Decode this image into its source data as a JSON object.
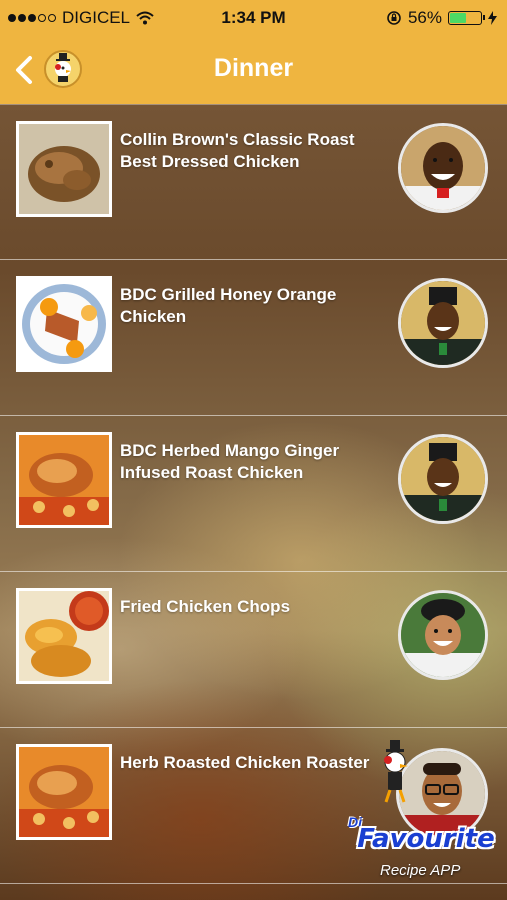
{
  "status_bar": {
    "carrier": "DIGICEL",
    "time": "1:34 PM",
    "battery_percent": "56%",
    "battery_level": 0.56,
    "signal_bars_filled": 3,
    "signal_bars_total": 5
  },
  "nav": {
    "title": "Dinner",
    "back_icon": "chevron-left-icon",
    "logo_icon": "chicken-mascot-icon"
  },
  "recipes": [
    {
      "title": "Collin Brown's Classic Roast Best Dressed Chicken"
    },
    {
      "title": "BDC Grilled Honey Orange Chicken"
    },
    {
      "title": "BDC Herbed Mango Ginger Infused Roast Chicken"
    },
    {
      "title": "Fried Chicken Chops"
    },
    {
      "title": "Herb Roasted Chicken Roaster"
    }
  ],
  "brand": {
    "name_prefix": "Di",
    "name": "Favourite",
    "subtitle": "Recipe APP"
  },
  "colors": {
    "header": "#efb540",
    "title_text": "#ffffff",
    "brand_blue": "#1a3fd1",
    "battery_green": "#4cd964"
  }
}
